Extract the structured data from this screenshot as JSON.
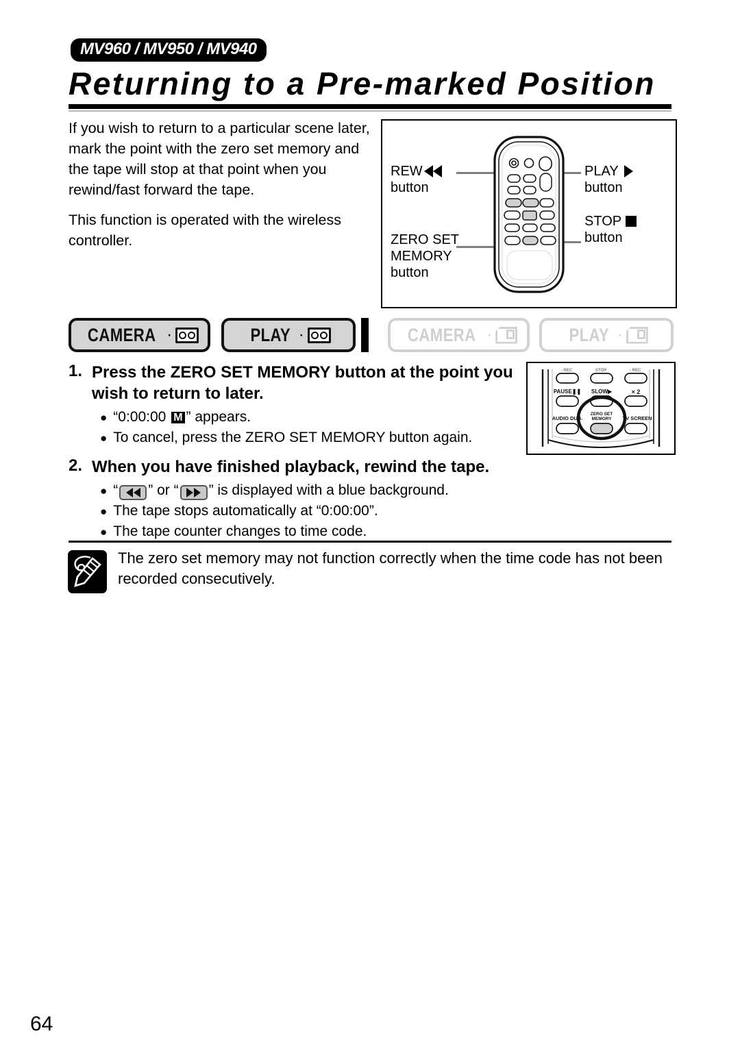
{
  "header": {
    "model_badge": "MV960 / MV950 / MV940",
    "title": "Returning to a Pre-marked Position"
  },
  "intro": {
    "paragraph1": "If you wish to return to a particular scene later, mark the point with the zero set memory and the tape will stop at that point when you rewind/fast forward the tape.",
    "paragraph2": "This function is operated with the wireless controller."
  },
  "remote_figure": {
    "labels": {
      "rew": "REW",
      "rew_sub": "button",
      "zero_set": "ZERO SET",
      "zero_set_line2": "MEMORY",
      "zero_set_sub": "button",
      "play": "PLAY",
      "play_sub": "button",
      "stop": "STOP",
      "stop_sub": "button"
    }
  },
  "mode_badges": [
    {
      "label": "CAMERA",
      "separator": "·",
      "media": "tape",
      "state": "active"
    },
    {
      "label": "PLAY",
      "separator": "·",
      "media": "tape",
      "state": "active"
    },
    {
      "label": "CAMERA",
      "separator": "·",
      "media": "card",
      "state": "inactive"
    },
    {
      "label": "PLAY",
      "separator": "·",
      "media": "card",
      "state": "inactive"
    }
  ],
  "steps": [
    {
      "number": "1.",
      "text": "Press the ZERO SET MEMORY button at the point you wish to return to later.",
      "bullets_pre": "“0:00:00 ",
      "bullet1_badge": "M",
      "bullets_post": "” appears.",
      "bullet2": "To cancel, press the ZERO SET MEMORY button again."
    },
    {
      "number": "2.",
      "text": "When you have finished playback, rewind the tape.",
      "bullet1_pre": "“",
      "bullet1_mid": "” or “",
      "bullet1_post": "” is displayed with a blue background.",
      "bullet2": "The tape stops automatically at “0:00:00”.",
      "bullet3": "The tape counter changes to time code."
    }
  ],
  "inset_figure": {
    "labels": {
      "pause": "PAUSE",
      "slow": "SLOW",
      "x2": "× 2",
      "audio_dub": "AUDIO DUB.",
      "zero_set_line1": "ZERO SET",
      "zero_set_line2": "MEMORY",
      "tv_screen": "TV SCREEN"
    }
  },
  "note": {
    "text": "The zero set memory may not function correctly when the time code has not been recorded consecutively."
  },
  "footer": {
    "page_number": "64"
  },
  "colors": {
    "ink": "#000000",
    "badge_active_fill": "#d4d4d4",
    "badge_inactive_stroke": "#d2d2d2",
    "leader_line": "#808080"
  }
}
